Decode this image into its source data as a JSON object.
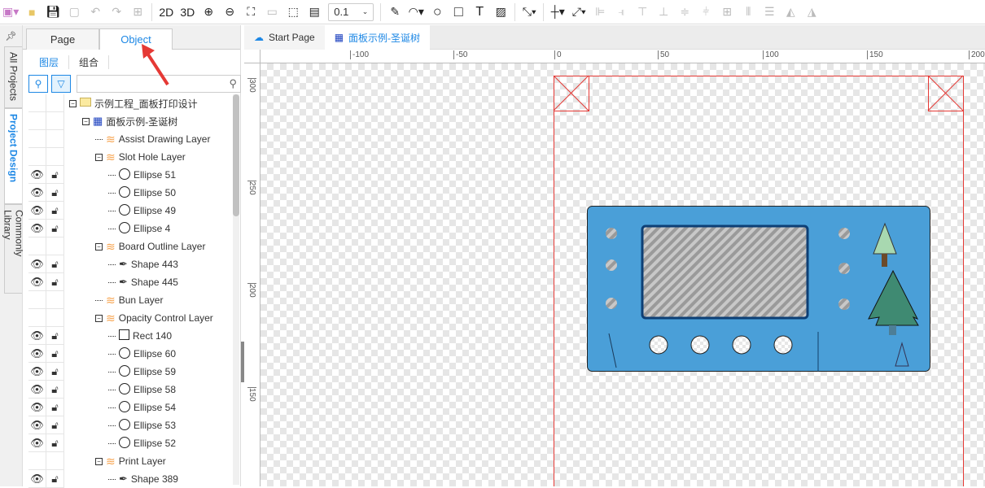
{
  "toolbar": {
    "view_2d": "2D",
    "view_3d": "3D",
    "zoom_value": "0.1"
  },
  "rail": {
    "tabs": [
      "All Projects",
      "Project Design",
      "Commonly Library"
    ]
  },
  "panel": {
    "tabs": [
      "Page",
      "Object"
    ],
    "subtabs": [
      "图层",
      "组合"
    ],
    "search_placeholder": ""
  },
  "tree": [
    {
      "label": "示例工程_面板打印设计",
      "icon": "folder-icon",
      "level": 0,
      "toggle": true,
      "vis": false
    },
    {
      "label": "面板示例-圣诞树",
      "icon": "panel-icon",
      "level": 1,
      "toggle": true,
      "vis": false
    },
    {
      "label": "Assist Drawing Layer",
      "icon": "layer-icon",
      "level": 2,
      "toggle": false,
      "vis": false
    },
    {
      "label": "Slot Hole Layer",
      "icon": "layer-icon",
      "level": 2,
      "toggle": true,
      "vis": false
    },
    {
      "label": "Ellipse 51",
      "icon": "ellipse-icon",
      "level": 3,
      "vis": true
    },
    {
      "label": "Ellipse 50",
      "icon": "ellipse-icon",
      "level": 3,
      "vis": true
    },
    {
      "label": "Ellipse 49",
      "icon": "ellipse-icon",
      "level": 3,
      "vis": true
    },
    {
      "label": "Ellipse 4",
      "icon": "ellipse-icon",
      "level": 3,
      "vis": true
    },
    {
      "label": "Board Outline Layer",
      "icon": "layer-icon",
      "level": 2,
      "toggle": true,
      "vis": false
    },
    {
      "label": "Shape 443",
      "icon": "pen-icon",
      "level": 3,
      "vis": true
    },
    {
      "label": "Shape 445",
      "icon": "pen-icon",
      "level": 3,
      "vis": true
    },
    {
      "label": "Bun Layer",
      "icon": "layer-icon",
      "level": 2,
      "toggle": false,
      "vis": false
    },
    {
      "label": "Opacity Control Layer",
      "icon": "layer-icon",
      "level": 2,
      "toggle": true,
      "vis": false
    },
    {
      "label": "Rect 140",
      "icon": "rect-icon",
      "level": 3,
      "vis": true
    },
    {
      "label": "Ellipse 60",
      "icon": "ellipse-icon",
      "level": 3,
      "vis": true
    },
    {
      "label": "Ellipse 59",
      "icon": "ellipse-icon",
      "level": 3,
      "vis": true
    },
    {
      "label": "Ellipse 58",
      "icon": "ellipse-icon",
      "level": 3,
      "vis": true
    },
    {
      "label": "Ellipse 54",
      "icon": "ellipse-icon",
      "level": 3,
      "vis": true
    },
    {
      "label": "Ellipse 53",
      "icon": "ellipse-icon",
      "level": 3,
      "vis": true
    },
    {
      "label": "Ellipse 52",
      "icon": "ellipse-icon",
      "level": 3,
      "vis": true
    },
    {
      "label": "Print Layer",
      "icon": "layer-icon",
      "level": 2,
      "toggle": true,
      "vis": false
    },
    {
      "label": "Shape 389",
      "icon": "pen-icon",
      "level": 3,
      "vis": true
    }
  ],
  "doc_tabs": [
    "Start Page",
    "面板示例-圣诞树"
  ],
  "ruler": {
    "h": [
      "-100",
      "-50",
      "0",
      "50",
      "100",
      "150",
      "200"
    ],
    "v": [
      "300",
      "250",
      "200",
      "150"
    ]
  },
  "colors": {
    "accent": "#1e88e5",
    "panel": "#4a9fd8",
    "page_border": "#e53935",
    "layer": "#f7a14a"
  }
}
